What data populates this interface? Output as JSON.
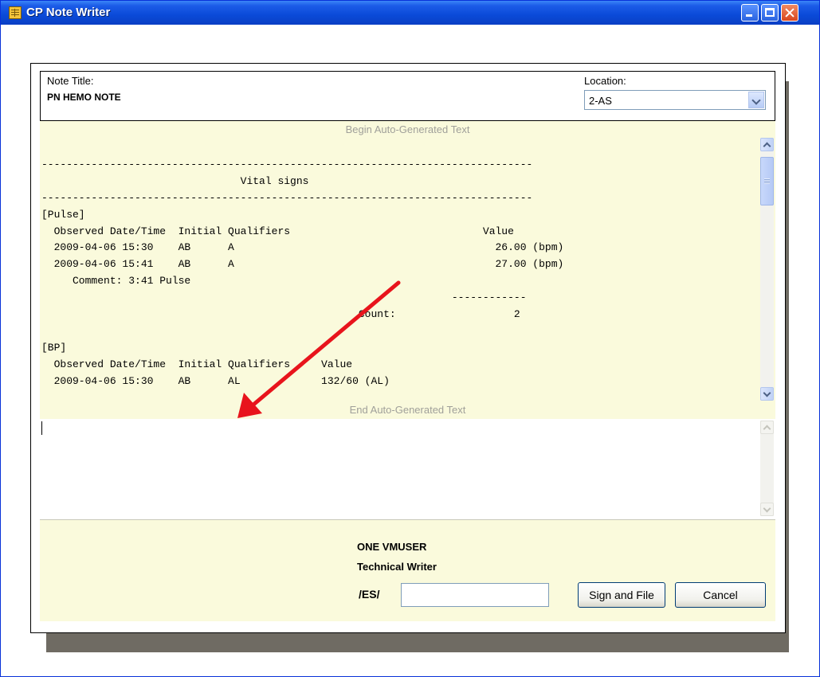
{
  "window": {
    "title": "CP Note Writer"
  },
  "header": {
    "note_title_label": "Note Title:",
    "note_title_value": "PN HEMO NOTE",
    "location_label": "Location:",
    "location_value": "2-AS"
  },
  "auto_text": {
    "begin_label": "Begin Auto-Generated Text",
    "end_label": "End Auto-Generated Text",
    "lines": [
      "",
      "-------------------------------------------------------------------------------",
      "                                Vital signs",
      "-------------------------------------------------------------------------------",
      "[Pulse]",
      "  Observed Date/Time  Initial Qualifiers                               Value",
      "  2009-04-06 15:30    AB      A                                          26.00 (bpm)",
      "  2009-04-06 15:41    AB      A                                          27.00 (bpm)",
      "     Comment: 3:41 Pulse",
      "                                                                  ------------",
      "                                                   Count:                   2",
      "",
      "[BP]",
      "  Observed Date/Time  Initial Qualifiers     Value",
      "  2009-04-06 15:30    AB      AL             132/60 (AL)"
    ]
  },
  "signature": {
    "name": "ONE VMUSER",
    "title": "Technical Writer",
    "es_label": "/ES/",
    "es_value": ""
  },
  "buttons": {
    "sign_and_file": "Sign and File",
    "cancel": "Cancel"
  },
  "icons": {
    "app": "notebook-icon",
    "minimize": "minimize-icon",
    "maximize": "maximize-icon",
    "close": "close-icon",
    "dropdown": "chevron-down-icon",
    "annotation": "red-arrow-icon"
  },
  "colors": {
    "titlebar": "#0a4ad8",
    "auto_text_bg": "#fafadc",
    "annotation_arrow": "#e8141c",
    "dialog_shadow": "#6f6b63"
  }
}
